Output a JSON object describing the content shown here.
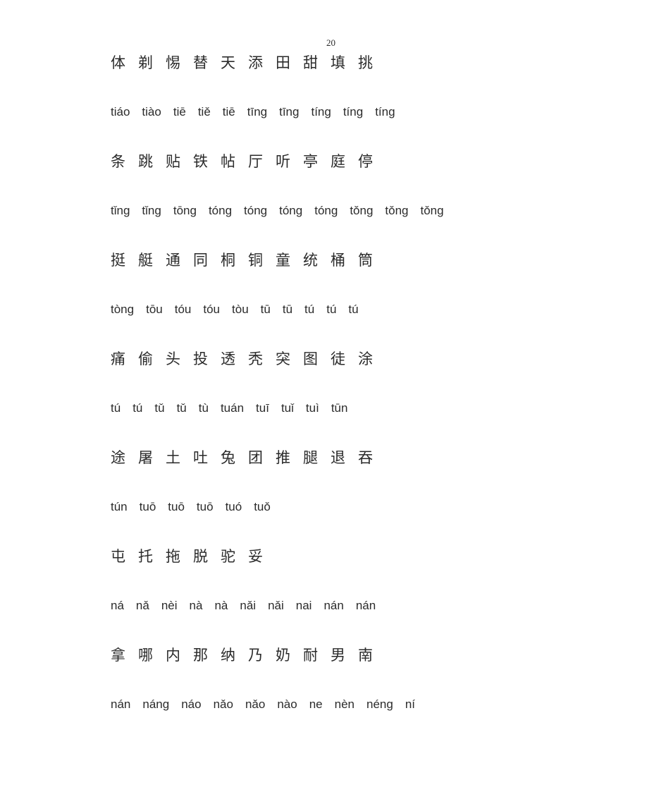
{
  "document": {
    "page_number": "20",
    "type": "chinese-pinyin-vocabulary-list",
    "text_color": "#2b2b2b",
    "background_color": "#ffffff"
  },
  "rows": [
    {
      "kind": "hanzi",
      "items": [
        "体",
        "剃",
        "惕",
        "替",
        "天",
        "添",
        "田",
        "甜",
        "填",
        "挑"
      ]
    },
    {
      "kind": "pinyin",
      "items": [
        "tiáo",
        "tiào",
        "tiē",
        "tiě",
        "tiē",
        "tīng",
        "tīng",
        "tíng",
        "tíng",
        "tíng"
      ]
    },
    {
      "kind": "hanzi",
      "items": [
        "条",
        "跳",
        "贴",
        "铁",
        "帖",
        "厅",
        "听",
        "亭",
        "庭",
        "停"
      ]
    },
    {
      "kind": "pinyin",
      "items": [
        "tǐng",
        "tǐng",
        "tōng",
        "tóng",
        "tóng",
        "tóng",
        "tóng",
        "tǒng",
        "tǒng",
        "tǒng"
      ]
    },
    {
      "kind": "hanzi",
      "items": [
        "挺",
        "艇",
        "通",
        "同",
        "桐",
        "铜",
        "童",
        "统",
        "桶",
        "筒"
      ]
    },
    {
      "kind": "pinyin",
      "items": [
        "tòng",
        "tōu",
        "tóu",
        "tóu",
        "tòu",
        "tū",
        "tū",
        "tú",
        "tú",
        "tú"
      ]
    },
    {
      "kind": "hanzi",
      "items": [
        "痛",
        "偷",
        "头",
        "投",
        "透",
        "秃",
        "突",
        "图",
        "徒",
        "涂"
      ]
    },
    {
      "kind": "pinyin",
      "items": [
        "tú",
        "tú",
        "tǔ",
        "tǔ",
        "tù",
        "tuán",
        "tuī",
        "tuǐ",
        "tuì",
        "tūn"
      ]
    },
    {
      "kind": "hanzi",
      "items": [
        "途",
        "屠",
        "土",
        "吐",
        "兔",
        "团",
        "推",
        "腿",
        "退",
        "吞"
      ]
    },
    {
      "kind": "pinyin",
      "items": [
        "tún",
        "tuō",
        "tuō",
        "tuō",
        "tuó",
        "tuǒ"
      ]
    },
    {
      "kind": "hanzi",
      "items": [
        "屯",
        "托",
        "拖",
        "脱",
        "驼",
        "妥"
      ]
    },
    {
      "kind": "pinyin",
      "items": [
        "ná",
        "nǎ",
        "nèi",
        "nà",
        "nà",
        "nǎi",
        "nǎi",
        "nai",
        "nán",
        "nán"
      ]
    },
    {
      "kind": "hanzi",
      "items": [
        "拿",
        "哪",
        "内",
        "那",
        "纳",
        "乃",
        "奶",
        "耐",
        "男",
        "南"
      ]
    },
    {
      "kind": "pinyin",
      "items": [
        "nán",
        "náng",
        "náo",
        "nǎo",
        "nǎo",
        "nào",
        "ne",
        "nèn",
        "néng",
        "ní"
      ]
    }
  ]
}
